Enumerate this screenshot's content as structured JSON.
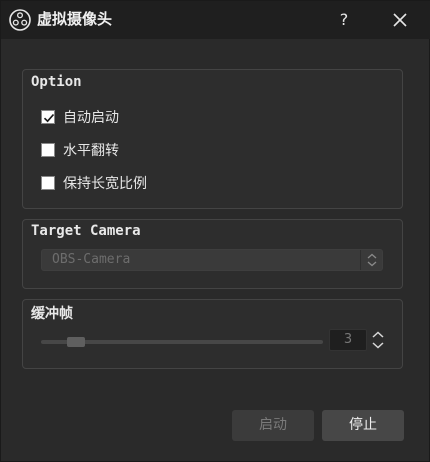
{
  "window": {
    "title": "虚拟摄像头",
    "help_label": "?"
  },
  "option_group": {
    "title": "Option",
    "items": [
      {
        "label": "自动启动",
        "checked": true
      },
      {
        "label": "水平翻转",
        "checked": false
      },
      {
        "label": "保持长宽比例",
        "checked": false
      }
    ]
  },
  "target_group": {
    "title": "Target Camera",
    "selected": "OBS-Camera",
    "disabled": true
  },
  "buffer_group": {
    "title": "缓冲帧",
    "value": "3",
    "slider_fraction": 0.1
  },
  "buttons": {
    "start_label": "启动",
    "stop_label": "停止"
  },
  "icons": {
    "app": "obs-logo-icon",
    "close": "close-icon",
    "checkmark": "checkmark-icon",
    "combo_arrows": "chevron-up-down-icon",
    "spin_arrows": "spin-up-down-icon"
  }
}
